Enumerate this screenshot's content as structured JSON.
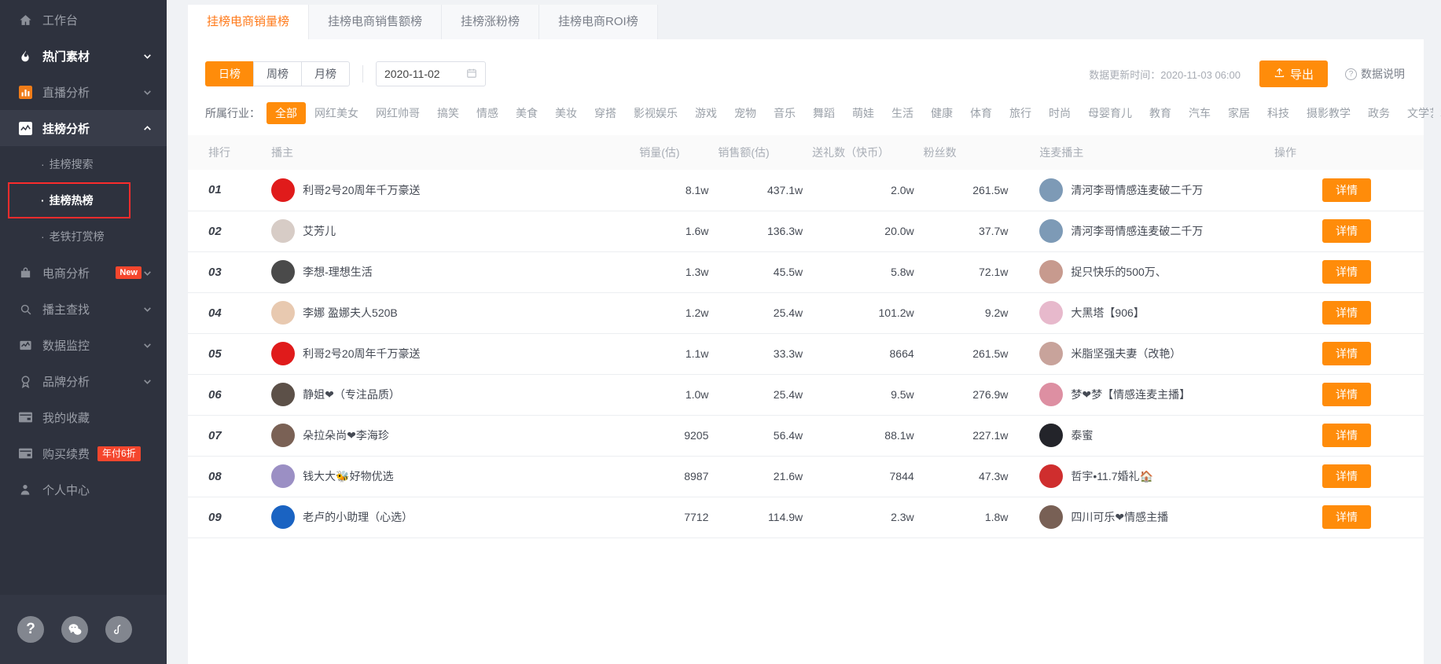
{
  "sidebar": {
    "items": [
      {
        "label": "工作台",
        "icon": "home-icon",
        "chevron": false,
        "active": false
      },
      {
        "label": "热门素材",
        "icon": "fire-icon",
        "chevron": true,
        "active": false,
        "bold": true
      },
      {
        "label": "直播分析",
        "icon": "bar-chart-icon",
        "chevron": true,
        "active": false
      },
      {
        "label": "挂榜分析",
        "icon": "line-chart-icon",
        "chevron": true,
        "active": true,
        "bold": true,
        "expanded": true
      }
    ],
    "sub_items": [
      {
        "label": "挂榜搜索",
        "selected": false
      },
      {
        "label": "挂榜热榜",
        "selected": true,
        "highlighted": true
      },
      {
        "label": "老铁打赏榜",
        "selected": false
      }
    ],
    "items_after": [
      {
        "label": "电商分析",
        "icon": "shop-icon",
        "chevron": true,
        "badge": "New"
      },
      {
        "label": "播主查找",
        "icon": "search-icon",
        "chevron": true
      },
      {
        "label": "数据监控",
        "icon": "monitor-icon",
        "chevron": true
      },
      {
        "label": "品牌分析",
        "icon": "brand-icon",
        "chevron": true
      },
      {
        "label": "我的收藏",
        "icon": "card-icon",
        "chevron": false
      },
      {
        "label": "购买续费",
        "icon": "card-icon",
        "chevron": false,
        "badge_sale": "年付6折"
      },
      {
        "label": "个人中心",
        "icon": "user-icon",
        "chevron": false
      }
    ],
    "footer_buttons": [
      {
        "name": "help-icon",
        "glyph": "?"
      },
      {
        "name": "wechat-icon",
        "glyph": "💬"
      },
      {
        "name": "kuaishou-icon",
        "glyph": "ʃ"
      }
    ]
  },
  "tabs": [
    {
      "label": "挂榜电商销量榜",
      "active": true
    },
    {
      "label": "挂榜电商销售额榜",
      "active": false
    },
    {
      "label": "挂榜涨粉榜",
      "active": false
    },
    {
      "label": "挂榜电商ROI榜",
      "active": false
    }
  ],
  "toolbar": {
    "period_options": [
      {
        "label": "日榜",
        "on": true
      },
      {
        "label": "周榜",
        "on": false
      },
      {
        "label": "月榜",
        "on": false
      }
    ],
    "date_value": "2020-11-02",
    "date_icon": "calendar-icon",
    "update_time": "数据更新时间：2020-11-03 06:00",
    "export_label": "导出",
    "export_icon": "upload-icon",
    "help_label": "数据说明",
    "help_icon": "question-circle-icon"
  },
  "industry": {
    "label": "所属行业：",
    "items": [
      {
        "label": "全部",
        "on": true
      },
      {
        "label": "网红美女",
        "on": false
      },
      {
        "label": "网红帅哥",
        "on": false
      },
      {
        "label": "搞笑",
        "on": false
      },
      {
        "label": "情感",
        "on": false
      },
      {
        "label": "美食",
        "on": false
      },
      {
        "label": "美妆",
        "on": false
      },
      {
        "label": "穿搭",
        "on": false
      },
      {
        "label": "影视娱乐",
        "on": false
      },
      {
        "label": "游戏",
        "on": false
      },
      {
        "label": "宠物",
        "on": false
      },
      {
        "label": "音乐",
        "on": false
      },
      {
        "label": "舞蹈",
        "on": false
      },
      {
        "label": "萌娃",
        "on": false
      },
      {
        "label": "生活",
        "on": false
      },
      {
        "label": "健康",
        "on": false
      },
      {
        "label": "体育",
        "on": false
      },
      {
        "label": "旅行",
        "on": false
      },
      {
        "label": "时尚",
        "on": false
      },
      {
        "label": "母婴育儿",
        "on": false
      },
      {
        "label": "教育",
        "on": false
      },
      {
        "label": "汽车",
        "on": false
      },
      {
        "label": "家居",
        "on": false
      },
      {
        "label": "科技",
        "on": false
      },
      {
        "label": "摄影教学",
        "on": false
      },
      {
        "label": "政务",
        "on": false
      },
      {
        "label": "文学艺术",
        "on": false
      }
    ]
  },
  "table": {
    "columns": [
      "排行",
      "播主",
      "销量(估)",
      "销售额(估)",
      "送礼数（快币）",
      "粉丝数",
      "连麦播主",
      "操作"
    ],
    "action_label": "详情",
    "rows": [
      {
        "rank": "01",
        "host": "利哥2号20周年千万豪送",
        "avatar_color": "#e01b1b",
        "sales": "8.1w",
        "amount": "437.1w",
        "gifts": "2.0w",
        "fans": "261.5w",
        "mic": "清河李哥情感连麦破二千万",
        "mic_avatar_color": "#7d9ab6"
      },
      {
        "rank": "02",
        "host": "艾芳儿",
        "avatar_color": "#d7ccc6",
        "sales": "1.6w",
        "amount": "136.3w",
        "gifts": "20.0w",
        "fans": "37.7w",
        "mic": "清河李哥情感连麦破二千万",
        "mic_avatar_color": "#7d9ab6"
      },
      {
        "rank": "03",
        "host": "李想-理想生活",
        "avatar_color": "#4a4a4a",
        "sales": "1.3w",
        "amount": "45.5w",
        "gifts": "5.8w",
        "fans": "72.1w",
        "mic": "捉只快乐的500万、",
        "mic_avatar_color": "#c79a8e"
      },
      {
        "rank": "04",
        "host": "李娜 盈娜夫人520B",
        "avatar_color": "#e8c9b0",
        "sales": "1.2w",
        "amount": "25.4w",
        "gifts": "101.2w",
        "fans": "9.2w",
        "mic": "大黑塔【906】",
        "mic_avatar_color": "#e7b9cc"
      },
      {
        "rank": "05",
        "host": "利哥2号20周年千万豪送",
        "avatar_color": "#e01b1b",
        "sales": "1.1w",
        "amount": "33.3w",
        "gifts": "8664",
        "fans": "261.5w",
        "mic": "米脂坚强夫妻（改艳）",
        "mic_avatar_color": "#c8a39b"
      },
      {
        "rank": "06",
        "host": "静姐❤（专注品质）",
        "avatar_color": "#5c5048",
        "sales": "1.0w",
        "amount": "25.4w",
        "gifts": "9.5w",
        "fans": "276.9w",
        "mic": "梦❤梦【情感连麦主播】",
        "mic_avatar_color": "#dd8fa2"
      },
      {
        "rank": "07",
        "host": "朵拉朵尚❤李海珍",
        "avatar_color": "#7a6155",
        "sales": "9205",
        "amount": "56.4w",
        "gifts": "88.1w",
        "fans": "227.1w",
        "mic": "泰蜜",
        "mic_avatar_color": "#23242a"
      },
      {
        "rank": "08",
        "host": "钱大大🐝好物优选",
        "avatar_color": "#9b8fc4",
        "sales": "8987",
        "amount": "21.6w",
        "gifts": "7844",
        "fans": "47.3w",
        "mic": "哲宇•11.7婚礼🏠",
        "mic_avatar_color": "#cf2e2e"
      },
      {
        "rank": "09",
        "host": "老卢的小助理（心选）",
        "avatar_color": "#1a63c2",
        "sales": "7712",
        "amount": "114.9w",
        "gifts": "2.3w",
        "fans": "1.8w",
        "mic": "四川可乐❤情感主播",
        "mic_avatar_color": "#786055"
      }
    ]
  },
  "colors": {
    "accent": "#ff8c0a",
    "sidebar_bg": "#2e323e",
    "highlight_box": "#fb2c2c",
    "badge_red": "#f5462d"
  }
}
